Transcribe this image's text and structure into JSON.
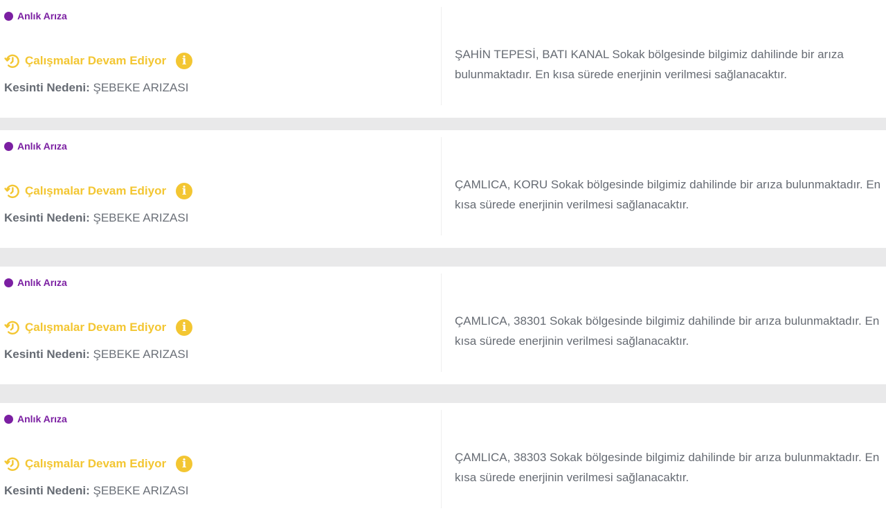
{
  "outages": [
    {
      "type": "Anlık Arıza",
      "status": "Çalışmalar Devam Ediyor",
      "reason_label": "Kesinti Nedeni:",
      "reason": "ŞEBEKE ARIZASI",
      "description": "ŞAHİN TEPESİ, BATI KANAL Sokak bölgesinde bilgimiz dahilinde bir arıza bulunmaktadır. En kısa sürede enerjinin verilmesi sağlanacaktır."
    },
    {
      "type": "Anlık Arıza",
      "status": "Çalışmalar Devam Ediyor",
      "reason_label": "Kesinti Nedeni:",
      "reason": "ŞEBEKE ARIZASI",
      "description": "ÇAMLICA, KORU Sokak bölgesinde bilgimiz dahilinde bir arıza bulunmaktadır. En kısa sürede enerjinin verilmesi sağlanacaktır."
    },
    {
      "type": "Anlık Arıza",
      "status": "Çalışmalar Devam Ediyor",
      "reason_label": "Kesinti Nedeni:",
      "reason": "ŞEBEKE ARIZASI",
      "description": "ÇAMLICA, 38301 Sokak bölgesinde bilgimiz dahilinde bir arıza bulunmaktadır. En kısa sürede enerjinin verilmesi sağlanacaktır."
    },
    {
      "type": "Anlık Arıza",
      "status": "Çalışmalar Devam Ediyor",
      "reason_label": "Kesinti Nedeni:",
      "reason": "ŞEBEKE ARIZASI",
      "description": "ÇAMLICA, 38303 Sokak bölgesinde bilgimiz dahilinde bir arıza bulunmaktadır. En kısa sürede enerjinin verilmesi sağlanacaktır."
    }
  ],
  "icons": {
    "badge_dot": "dot-icon",
    "status": "clock-progress-icon",
    "info": "info-icon",
    "info_glyph": "i"
  },
  "colors": {
    "badge": "#7b1fa2",
    "status": "#f3c632",
    "text": "#666b73",
    "page_background": "#e9e9ea",
    "card_background": "#ffffff"
  }
}
